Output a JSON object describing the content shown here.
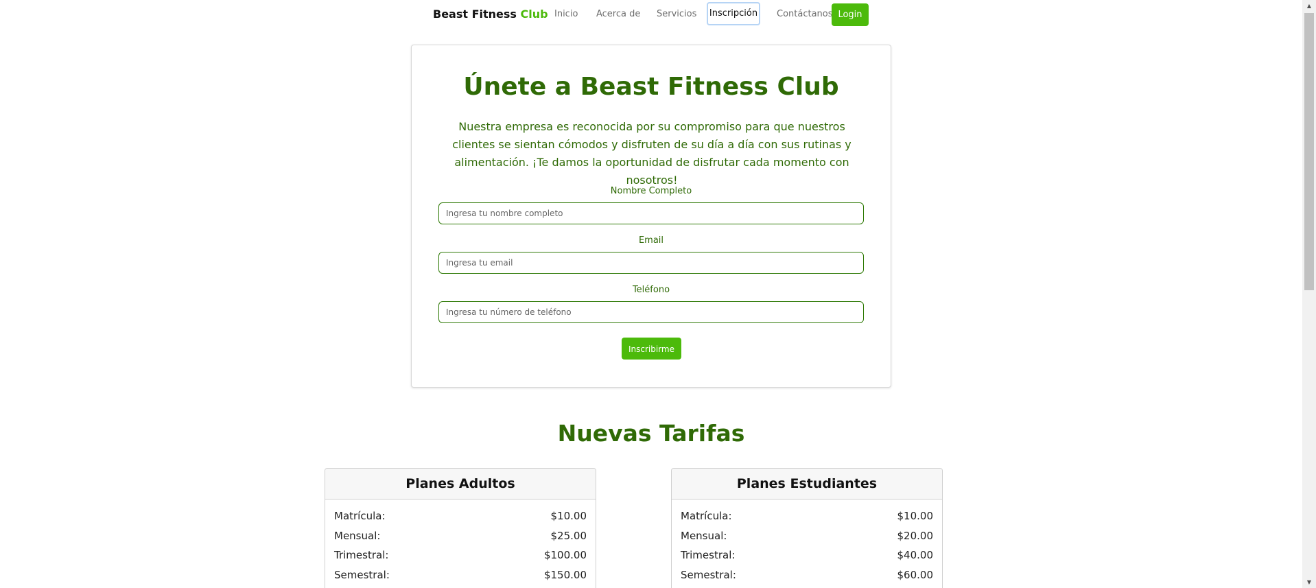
{
  "nav": {
    "brand_main": "Beast Fitness",
    "brand_accent": "Club",
    "links": [
      "Inicio",
      "Acerca de",
      "Servicios",
      "Inscripción",
      "Contáctanos"
    ],
    "login_label": "Login"
  },
  "signup": {
    "title": "Únete a Beast Fitness Club",
    "description": "Nuestra empresa es reconocida por su compromiso para que nuestros clientes se sientan cómodos y disfruten de su día a día con sus rutinas y alimentación. ¡Te damos la oportunidad de disfrutar cada momento con nosotros!",
    "fields": [
      {
        "label": "Nombre Completo",
        "placeholder": "Ingresa tu nombre completo"
      },
      {
        "label": "Email",
        "placeholder": "Ingresa tu email"
      },
      {
        "label": "Teléfono",
        "placeholder": "Ingresa tu número de teléfono"
      }
    ],
    "submit_label": "Inscribirme"
  },
  "pricing": {
    "title": "Nuevas Tarifas",
    "plans": [
      {
        "name": "Planes Adultos",
        "rows": [
          {
            "label": "Matrícula:",
            "price": "$10.00"
          },
          {
            "label": "Mensual:",
            "price": "$25.00"
          },
          {
            "label": "Trimestral:",
            "price": "$100.00"
          },
          {
            "label": "Semestral:",
            "price": "$150.00"
          }
        ]
      },
      {
        "name": "Planes Estudiantes",
        "rows": [
          {
            "label": "Matrícula:",
            "price": "$10.00"
          },
          {
            "label": "Mensual:",
            "price": "$20.00"
          },
          {
            "label": "Trimestral:",
            "price": "$40.00"
          },
          {
            "label": "Semestral:",
            "price": "$60.00"
          }
        ]
      }
    ]
  },
  "scrollbar": {
    "up_icon": "scroll-up-arrow-icon",
    "down_icon": "scroll-down-arrow-icon"
  },
  "colors": {
    "brand_green": "#4cba0b",
    "dark_green": "#2f6a06",
    "active_outline": "#b6d4f5"
  }
}
